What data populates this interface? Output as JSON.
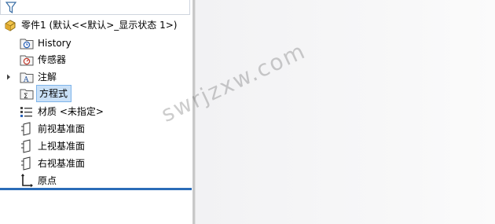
{
  "tree": {
    "part": {
      "label": "零件1 (默认<<默认>_显示状态 1>)",
      "icon": "part-icon"
    },
    "items": [
      {
        "label": "History",
        "icon": "history-folder-icon"
      },
      {
        "label": "传感器",
        "icon": "sensors-folder-icon"
      },
      {
        "label": "注解",
        "icon": "annotations-folder-icon"
      },
      {
        "label": "方程式",
        "icon": "equations-folder-icon"
      },
      {
        "label": "材质 <未指定>",
        "icon": "material-icon"
      },
      {
        "label": "前视基准面",
        "icon": "plane-icon"
      },
      {
        "label": "上视基准面",
        "icon": "plane-icon"
      },
      {
        "label": "右视基准面",
        "icon": "plane-icon"
      },
      {
        "label": "原点",
        "icon": "origin-icon"
      }
    ]
  },
  "watermark": "swrjzxw.com",
  "colors": {
    "selection": "#c9e0f7",
    "accent_line": "#2b6cb8",
    "folder": "#e8c25a"
  }
}
